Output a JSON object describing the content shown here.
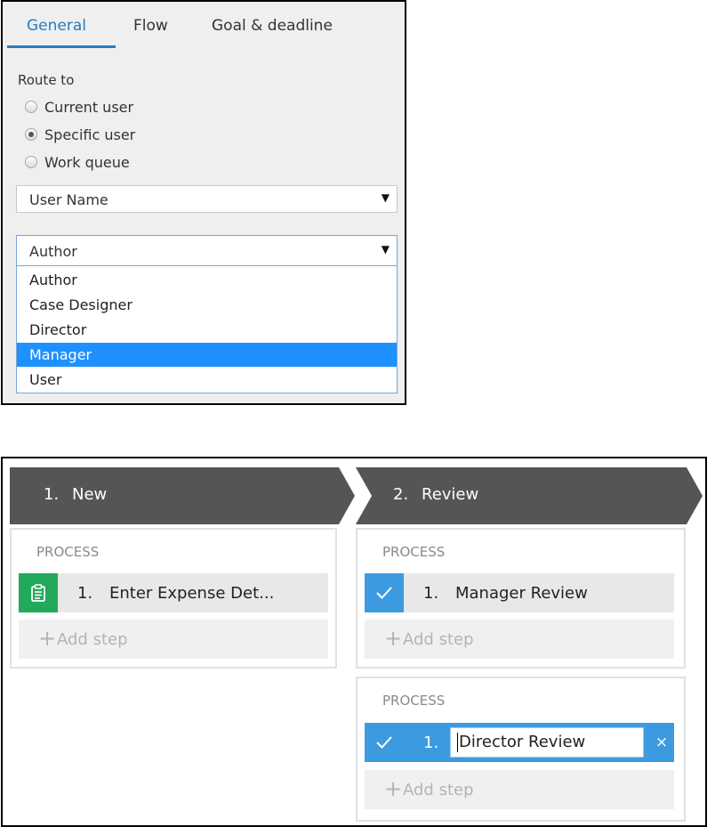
{
  "panel1": {
    "tabs": [
      {
        "label": "General",
        "active": true
      },
      {
        "label": "Flow",
        "active": false
      },
      {
        "label": "Goal & deadline",
        "active": false
      }
    ],
    "route_to_label": "Route to",
    "radios": [
      {
        "label": "Current user",
        "checked": false
      },
      {
        "label": "Specific user",
        "checked": true
      },
      {
        "label": "Work queue",
        "checked": false
      }
    ],
    "select_user_type": {
      "value": "User Name",
      "icon": "caret-down-icon"
    },
    "select_role": {
      "value": "Author",
      "icon": "caret-down-icon",
      "open": true
    },
    "options": [
      {
        "label": "Author",
        "selected": false
      },
      {
        "label": "Case Designer",
        "selected": false
      },
      {
        "label": "Director",
        "selected": false
      },
      {
        "label": "Manager",
        "selected": true
      },
      {
        "label": "User",
        "selected": false
      }
    ],
    "colors": {
      "accent": "#2a7bbd",
      "selected_option": "#1e90ff"
    }
  },
  "panel2": {
    "stages": [
      {
        "number": "1.",
        "title": "New",
        "processes": [
          {
            "label": "PROCESS",
            "steps": [
              {
                "number": "1.",
                "name": "Enter Expense Det...",
                "icon": "clipboard-icon",
                "icon_color": "#23a95c"
              }
            ],
            "add_step": {
              "plus": "+",
              "label": "Add step"
            }
          }
        ]
      },
      {
        "number": "2.",
        "title": "Review",
        "processes": [
          {
            "label": "PROCESS",
            "steps": [
              {
                "number": "1.",
                "name": "Manager Review",
                "icon": "check-icon",
                "icon_color": "#3c9be0"
              }
            ],
            "add_step": {
              "plus": "+",
              "label": "Add step"
            }
          },
          {
            "label": "PROCESS",
            "steps": [
              {
                "number": "1.",
                "name": "Director Review",
                "icon": "check-icon",
                "icon_color": "#3c9be0",
                "editing": true,
                "close_icon": "×"
              }
            ],
            "add_step": {
              "plus": "+",
              "label": "Add step"
            }
          }
        ]
      }
    ],
    "colors": {
      "stage_header": "#555555",
      "check_blue": "#3c9be0",
      "clipboard_green": "#23a95c"
    }
  }
}
